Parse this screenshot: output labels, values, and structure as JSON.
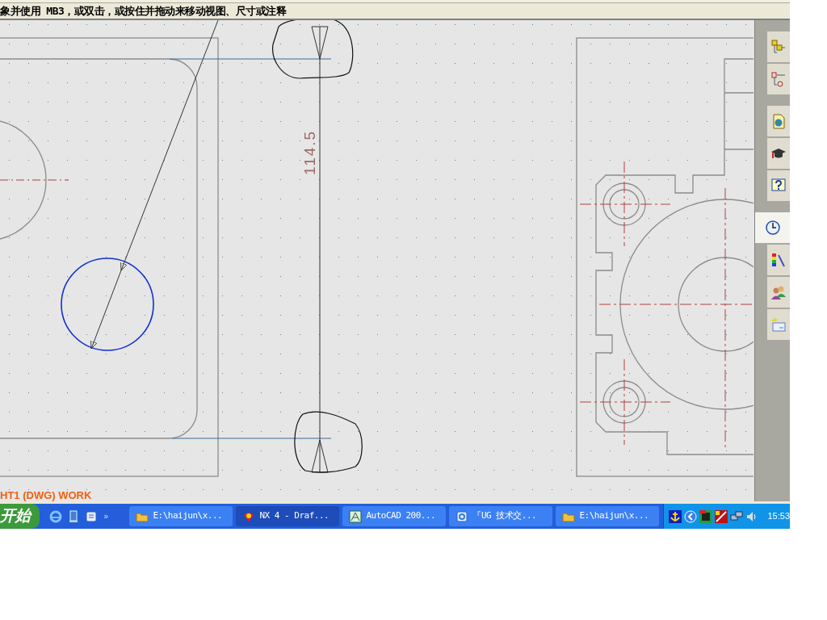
{
  "prompt": "象并使用 MB3，或双击，或按住并拖动来移动视图、尺寸或注释",
  "canvas": {
    "dimension": "114.5",
    "view_label": "HT1 (DWG) WORK"
  },
  "resource_bar": {
    "groups": [
      [
        {
          "selected": false
        },
        {
          "selected": false
        }
      ],
      [
        {
          "selected": false
        },
        {
          "selected": false
        },
        {
          "selected": false
        }
      ],
      [
        {
          "selected": true
        },
        {
          "selected": false
        },
        {
          "selected": false
        },
        {
          "selected": false
        }
      ]
    ]
  },
  "taskbar": {
    "start": "开始",
    "more": "»",
    "tasks": [
      {
        "label": "E:\\haijun\\x...",
        "selected": false
      },
      {
        "label": "NX 4 - Draf...",
        "selected": true
      },
      {
        "label": "AutoCAD 200...",
        "selected": false
      },
      {
        "label": "『UG 技术交...",
        "selected": false
      },
      {
        "label": "E:\\haijun\\x...",
        "selected": false
      }
    ],
    "clock": "15:53"
  }
}
